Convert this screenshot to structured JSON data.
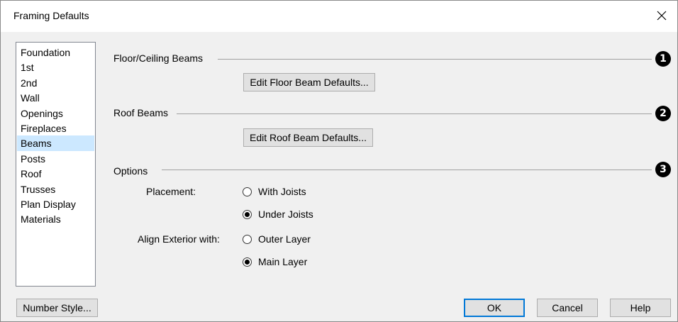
{
  "window": {
    "title": "Framing Defaults"
  },
  "nav": {
    "items": [
      {
        "label": "Foundation",
        "selected": false
      },
      {
        "label": "1st",
        "selected": false
      },
      {
        "label": "2nd",
        "selected": false
      },
      {
        "label": "Wall",
        "selected": false
      },
      {
        "label": "Openings",
        "selected": false
      },
      {
        "label": "Fireplaces",
        "selected": false
      },
      {
        "label": "Beams",
        "selected": true
      },
      {
        "label": "Posts",
        "selected": false
      },
      {
        "label": "Roof",
        "selected": false
      },
      {
        "label": "Trusses",
        "selected": false
      },
      {
        "label": "Plan Display",
        "selected": false
      },
      {
        "label": "Materials",
        "selected": false
      }
    ]
  },
  "sections": {
    "floor": {
      "title": "Floor/Ceiling Beams",
      "button": "Edit Floor Beam Defaults...",
      "callout": "1"
    },
    "roof": {
      "title": "Roof Beams",
      "button": "Edit Roof Beam Defaults...",
      "callout": "2"
    },
    "options": {
      "title": "Options",
      "callout": "3",
      "placement": {
        "label": "Placement:",
        "options": [
          {
            "label": "With Joists",
            "checked": false
          },
          {
            "label": "Under Joists",
            "checked": true
          }
        ]
      },
      "align": {
        "label": "Align Exterior with:",
        "options": [
          {
            "label": "Outer Layer",
            "checked": false
          },
          {
            "label": "Main Layer",
            "checked": true
          }
        ]
      }
    }
  },
  "footer": {
    "number_style": "Number Style...",
    "ok": "OK",
    "cancel": "Cancel",
    "help": "Help"
  },
  "colors": {
    "selection": "#cce8ff",
    "default_button_border": "#0078d7"
  }
}
